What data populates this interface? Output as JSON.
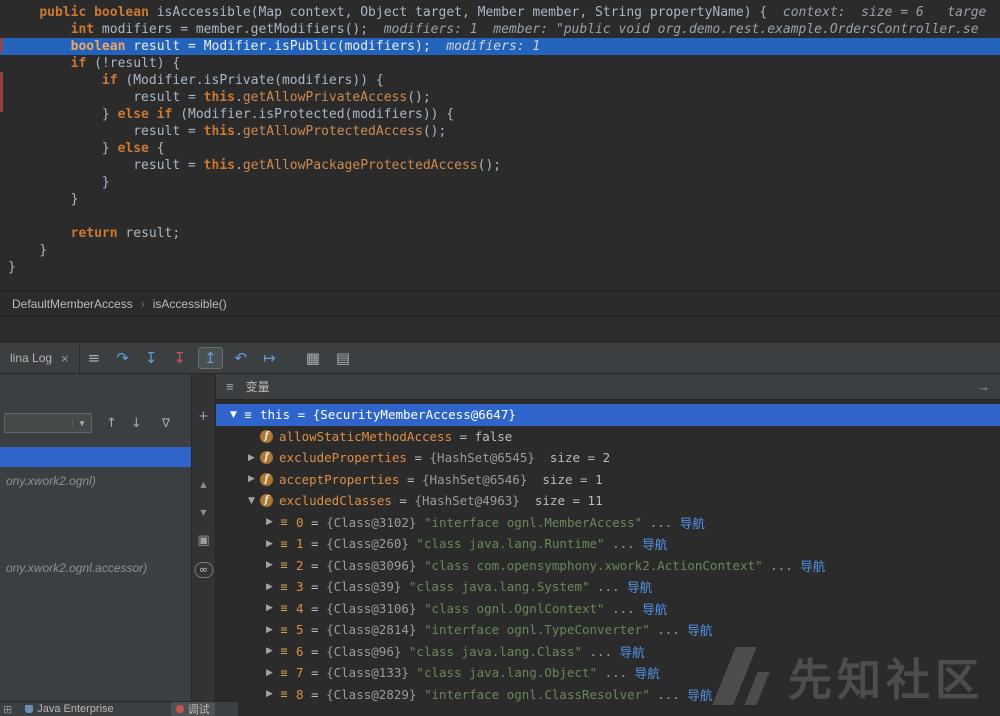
{
  "editor": {
    "exec_line_index": 2,
    "lines": [
      [
        [
          "p",
          "    "
        ],
        [
          "k",
          "public"
        ],
        [
          "p",
          " "
        ],
        [
          "k",
          "boolean"
        ],
        [
          "p",
          " isAccessible(Map context, Object target, Member member, String propertyName) {  "
        ],
        [
          "h",
          "context:  size = 6   targe"
        ]
      ],
      [
        [
          "p",
          "        "
        ],
        [
          "k",
          "int"
        ],
        [
          "p",
          " modifiers = member.getModifiers();  "
        ],
        [
          "h",
          "modifiers: 1  member: \"public void org.demo.rest.example.OrdersController.se"
        ]
      ],
      [
        [
          "p",
          "        "
        ],
        [
          "k",
          "boolean"
        ],
        [
          "p",
          " result = Modifier.isPublic(modifiers);  "
        ],
        [
          "h",
          "modifiers: 1"
        ]
      ],
      [
        [
          "p",
          "        "
        ],
        [
          "k",
          "if"
        ],
        [
          "p",
          " (!result) {"
        ]
      ],
      [
        [
          "p",
          "            "
        ],
        [
          "k",
          "if"
        ],
        [
          "p",
          " (Modifier.isPrivate(modifiers)) {"
        ]
      ],
      [
        [
          "p",
          "                result = "
        ],
        [
          "k",
          "this"
        ],
        [
          "p",
          "."
        ],
        [
          "m",
          "getAllowPrivateAccess"
        ],
        [
          "p",
          "();"
        ]
      ],
      [
        [
          "p",
          "            } "
        ],
        [
          "k",
          "else"
        ],
        [
          "p",
          " "
        ],
        [
          "k",
          "if"
        ],
        [
          "p",
          " (Modifier.isProtected(modifiers)) {"
        ]
      ],
      [
        [
          "p",
          "                result = "
        ],
        [
          "k",
          "this"
        ],
        [
          "p",
          "."
        ],
        [
          "m",
          "getAllowProtectedAccess"
        ],
        [
          "p",
          "();"
        ]
      ],
      [
        [
          "p",
          "            } "
        ],
        [
          "k",
          "else"
        ],
        [
          "p",
          " {"
        ]
      ],
      [
        [
          "p",
          "                result = "
        ],
        [
          "k",
          "this"
        ],
        [
          "p",
          "."
        ],
        [
          "m",
          "getAllowPackageProtectedAccess"
        ],
        [
          "p",
          "();"
        ]
      ],
      [
        [
          "p",
          "            }"
        ]
      ],
      [
        [
          "p",
          "        }"
        ]
      ],
      [],
      [
        [
          "p",
          "        "
        ],
        [
          "k",
          "return"
        ],
        [
          "p",
          " result;"
        ]
      ],
      [
        [
          "p",
          "    }"
        ]
      ],
      [
        [
          "p",
          "}"
        ]
      ]
    ]
  },
  "breadcrumb": {
    "separator": "›",
    "items": [
      {
        "label": "DefaultMemberAccess"
      },
      {
        "label": "isAccessible()"
      }
    ]
  },
  "toolbar": {
    "tab": {
      "label": "lina Log",
      "close_glyph": "×"
    },
    "icons": [
      {
        "name": "toolbar-menu-icon",
        "glyph": "≡",
        "cls": "gray"
      },
      {
        "name": "step-over-icon",
        "glyph": "↷",
        "cls": "blue"
      },
      {
        "name": "step-into-icon",
        "glyph": "↧",
        "cls": "blue"
      },
      {
        "name": "force-step-into-icon",
        "glyph": "↧",
        "cls": "red"
      },
      {
        "name": "step-out-icon",
        "glyph": "↥",
        "cls": "blue active"
      },
      {
        "name": "drop-frame-icon",
        "glyph": "↶",
        "cls": "blue"
      },
      {
        "name": "run-to-cursor-icon",
        "glyph": "↦",
        "cls": "blue"
      },
      {
        "name": "view-breakpoints-icon",
        "glyph": "▦",
        "cls": "gray gap"
      },
      {
        "name": "mute-breakpoints-icon",
        "glyph": "▤",
        "cls": "gray"
      }
    ]
  },
  "frames": {
    "selector_value": "",
    "dropdown_glyph": "▼",
    "up_glyph": "↑",
    "down_glyph": "↓",
    "filter_glyph": "∇",
    "rows": [
      {
        "type": "selected",
        "text": ""
      },
      {
        "type": "dim",
        "text": "ony.xwork2.ognl)"
      },
      {
        "type": "dim",
        "text": "ony.xwork2.ognl.accessor)"
      }
    ]
  },
  "strip_icons": [
    {
      "name": "add-watch-icon",
      "glyph": "+",
      "cls": ""
    },
    {
      "name": "scroll-up-icon",
      "glyph": "▲",
      "cls": "small"
    },
    {
      "name": "scroll-down-icon",
      "glyph": "▼",
      "cls": "small"
    },
    {
      "name": "copy-stack-icon",
      "glyph": "▣",
      "cls": ""
    },
    {
      "name": "evaluate-watch-icon",
      "glyph": "∞",
      "cls": "badge"
    }
  ],
  "variables": {
    "title": "变量",
    "menu_glyph": "≡",
    "pin_glyph": "→",
    "rows": [
      {
        "level": 0,
        "arrow": "exp",
        "icon": "this",
        "selected": true,
        "row_name": "variable-this",
        "parts": [
          {
            "c": "name",
            "t": "this"
          },
          {
            "c": "eq",
            "t": " = "
          },
          {
            "c": "ref",
            "t": "{SecurityMemberAccess@6647}"
          }
        ]
      },
      {
        "level": 1,
        "arrow": null,
        "icon": "field",
        "row_name": "variable-allowStaticMethodAccess",
        "parts": [
          {
            "c": "name",
            "t": "allowStaticMethodAccess"
          },
          {
            "c": "eq",
            "t": " = "
          },
          {
            "c": "plain",
            "t": "false"
          }
        ]
      },
      {
        "level": 1,
        "arrow": "col",
        "icon": "field",
        "row_name": "variable-excludeProperties",
        "parts": [
          {
            "c": "name",
            "t": "excludeProperties"
          },
          {
            "c": "eq",
            "t": " = "
          },
          {
            "c": "ref",
            "t": "{HashSet@6545}"
          },
          {
            "c": "size",
            "t": "  size = 2"
          }
        ]
      },
      {
        "level": 1,
        "arrow": "col",
        "icon": "field",
        "row_name": "variable-acceptProperties",
        "parts": [
          {
            "c": "name",
            "t": "acceptProperties"
          },
          {
            "c": "eq",
            "t": " = "
          },
          {
            "c": "ref",
            "t": "{HashSet@6546}"
          },
          {
            "c": "size",
            "t": "  size = 1"
          }
        ]
      },
      {
        "level": 1,
        "arrow": "exp",
        "icon": "field",
        "row_name": "variable-excludedClasses",
        "parts": [
          {
            "c": "name",
            "t": "excludedClasses"
          },
          {
            "c": "eq",
            "t": " = "
          },
          {
            "c": "ref",
            "t": "{HashSet@4963}"
          },
          {
            "c": "size",
            "t": "  size = 11"
          }
        ]
      },
      {
        "level": 2,
        "arrow": "col",
        "icon": "item",
        "row_name": "excluded-class-0",
        "parts": [
          {
            "c": "name",
            "t": "0"
          },
          {
            "c": "eq",
            "t": " = "
          },
          {
            "c": "ref",
            "t": "{Class@3102} "
          },
          {
            "c": "str",
            "t": "\"interface ognl.MemberAccess\""
          },
          {
            "c": "dots",
            "t": " ... "
          },
          {
            "c": "link",
            "t": "导航"
          }
        ]
      },
      {
        "level": 2,
        "arrow": "col",
        "icon": "item",
        "row_name": "excluded-class-1",
        "parts": [
          {
            "c": "name",
            "t": "1"
          },
          {
            "c": "eq",
            "t": " = "
          },
          {
            "c": "ref",
            "t": "{Class@260} "
          },
          {
            "c": "str",
            "t": "\"class java.lang.Runtime\""
          },
          {
            "c": "dots",
            "t": " ... "
          },
          {
            "c": "link",
            "t": "导航"
          }
        ]
      },
      {
        "level": 2,
        "arrow": "col",
        "icon": "item",
        "row_name": "excluded-class-2",
        "parts": [
          {
            "c": "name",
            "t": "2"
          },
          {
            "c": "eq",
            "t": " = "
          },
          {
            "c": "ref",
            "t": "{Class@3096} "
          },
          {
            "c": "str",
            "t": "\"class com.opensymphony.xwork2.ActionContext\""
          },
          {
            "c": "dots",
            "t": " ... "
          },
          {
            "c": "link",
            "t": "导航"
          }
        ]
      },
      {
        "level": 2,
        "arrow": "col",
        "icon": "item",
        "row_name": "excluded-class-3",
        "parts": [
          {
            "c": "name",
            "t": "3"
          },
          {
            "c": "eq",
            "t": " = "
          },
          {
            "c": "ref",
            "t": "{Class@39} "
          },
          {
            "c": "str",
            "t": "\"class java.lang.System\""
          },
          {
            "c": "dots",
            "t": " ... "
          },
          {
            "c": "link",
            "t": "导航"
          }
        ]
      },
      {
        "level": 2,
        "arrow": "col",
        "icon": "item",
        "row_name": "excluded-class-4",
        "parts": [
          {
            "c": "name",
            "t": "4"
          },
          {
            "c": "eq",
            "t": " = "
          },
          {
            "c": "ref",
            "t": "{Class@3106} "
          },
          {
            "c": "str",
            "t": "\"class ognl.OgnlContext\""
          },
          {
            "c": "dots",
            "t": " ... "
          },
          {
            "c": "link",
            "t": "导航"
          }
        ]
      },
      {
        "level": 2,
        "arrow": "col",
        "icon": "item",
        "row_name": "excluded-class-5",
        "parts": [
          {
            "c": "name",
            "t": "5"
          },
          {
            "c": "eq",
            "t": " = "
          },
          {
            "c": "ref",
            "t": "{Class@2814} "
          },
          {
            "c": "str",
            "t": "\"interface ognl.TypeConverter\""
          },
          {
            "c": "dots",
            "t": " ... "
          },
          {
            "c": "link",
            "t": "导航"
          }
        ]
      },
      {
        "level": 2,
        "arrow": "col",
        "icon": "item",
        "row_name": "excluded-class-6",
        "parts": [
          {
            "c": "name",
            "t": "6"
          },
          {
            "c": "eq",
            "t": " = "
          },
          {
            "c": "ref",
            "t": "{Class@96} "
          },
          {
            "c": "str",
            "t": "\"class java.lang.Class\""
          },
          {
            "c": "dots",
            "t": " ... "
          },
          {
            "c": "link",
            "t": "导航"
          }
        ]
      },
      {
        "level": 2,
        "arrow": "col",
        "icon": "item",
        "row_name": "excluded-class-7",
        "parts": [
          {
            "c": "name",
            "t": "7"
          },
          {
            "c": "eq",
            "t": " = "
          },
          {
            "c": "ref",
            "t": "{Class@133} "
          },
          {
            "c": "str",
            "t": "\"class java.lang.Object\""
          },
          {
            "c": "dots",
            "t": " ... "
          },
          {
            "c": "link",
            "t": "导航"
          }
        ]
      },
      {
        "level": 2,
        "arrow": "col",
        "icon": "item",
        "row_name": "excluded-class-8",
        "parts": [
          {
            "c": "name",
            "t": "8"
          },
          {
            "c": "eq",
            "t": " = "
          },
          {
            "c": "ref",
            "t": "{Class@2829} "
          },
          {
            "c": "str",
            "t": "\"interface ognl.ClassResolver\""
          },
          {
            "c": "dots",
            "t": " ... "
          },
          {
            "c": "link",
            "t": "导航"
          }
        ]
      }
    ]
  },
  "statusbar": {
    "items": [
      {
        "label": "Java Enterprise"
      },
      {
        "label": "调试"
      }
    ]
  },
  "watermark": {
    "text": "先知社区"
  }
}
